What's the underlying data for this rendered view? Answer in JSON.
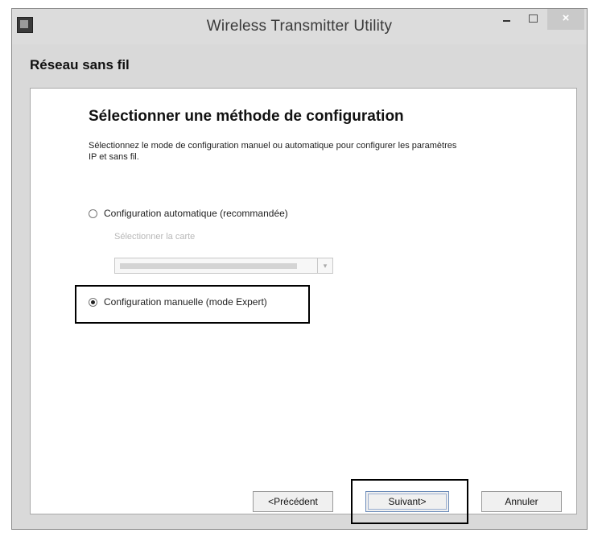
{
  "window": {
    "title": "Wireless Transmitter Utility",
    "close_symbol": "×"
  },
  "section": {
    "title": "Réseau sans fil"
  },
  "main": {
    "heading": "Sélectionner une méthode de configuration",
    "description": "Sélectionnez le mode de configuration manuel ou automatique pour configurer les paramètres IP et sans fil.",
    "options": [
      {
        "label": "Configuration automatique (recommandée)",
        "selected": false
      },
      {
        "label": "Configuration manuelle (mode Expert)",
        "selected": true
      }
    ],
    "card_label": "Sélectionner la carte",
    "card_select_arrow": "▾"
  },
  "buttons": {
    "prev": "<Précédent",
    "next": "Suivant>",
    "cancel": "Annuler"
  },
  "icons": {
    "app": "app-icon",
    "minimize": "minimize-icon",
    "maximize": "maximize-icon",
    "close": "close-icon",
    "dropdown": "chevron-down-icon"
  },
  "colors": {
    "window_bg": "#d9d9d9",
    "panel_bg": "#ffffff",
    "highlight_border": "#000000",
    "default_button_border": "#6a8ab8"
  }
}
